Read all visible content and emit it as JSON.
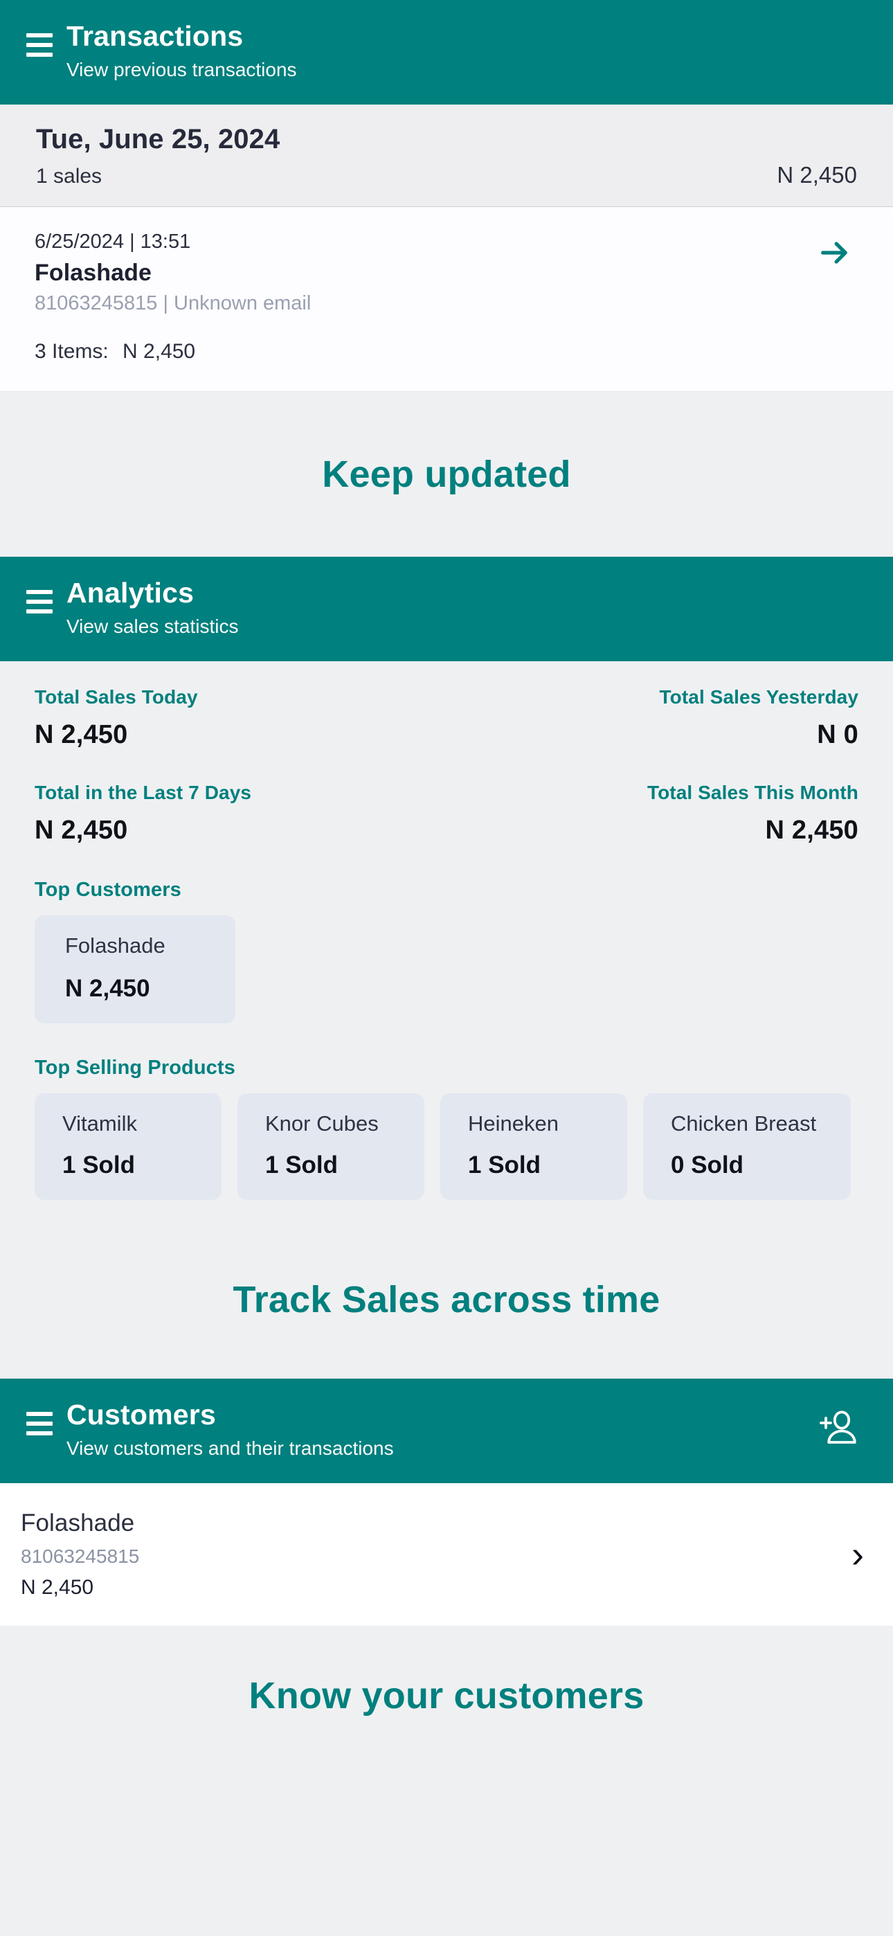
{
  "transactions": {
    "header": {
      "title": "Transactions",
      "subtitle": "View previous transactions",
      "menu_icon": "hamburger-menu-icon"
    },
    "date_group": {
      "date": "Tue, June 25, 2024",
      "sales_count": "1 sales",
      "total": "N 2,450"
    },
    "items": [
      {
        "timestamp": "6/25/2024 | 13:51",
        "customer": "Folashade",
        "contact": "81063245815 | Unknown email",
        "items_label": "3 Items:",
        "items_total": "N 2,450",
        "action_icon": "arrow-right-icon"
      }
    ]
  },
  "promo_1": {
    "text": "Keep updated"
  },
  "analytics": {
    "header": {
      "title": "Analytics",
      "subtitle": "View sales statistics",
      "menu_icon": "hamburger-menu-icon"
    },
    "stats": [
      {
        "label": "Total Sales Today",
        "value": "N 2,450"
      },
      {
        "label": "Total Sales Yesterday",
        "value": "N 0"
      },
      {
        "label": "Total in the Last 7 Days",
        "value": "N 2,450"
      },
      {
        "label": "Total Sales This Month",
        "value": "N 2,450"
      }
    ],
    "top_customers_label": "Top Customers",
    "top_customers": [
      {
        "name": "Folashade",
        "value": "N 2,450"
      }
    ],
    "top_products_label": "Top Selling Products",
    "top_products": [
      {
        "name": "Vitamilk",
        "value": "1 Sold"
      },
      {
        "name": "Knor Cubes",
        "value": "1 Sold"
      },
      {
        "name": "Heineken",
        "value": "1 Sold"
      },
      {
        "name": "Chicken Breast",
        "value": "0 Sold"
      }
    ]
  },
  "promo_2": {
    "text": "Track Sales across time"
  },
  "customers": {
    "header": {
      "title": "Customers",
      "subtitle": "View customers and their transactions",
      "menu_icon": "hamburger-menu-icon",
      "add_icon": "add-person-icon"
    },
    "rows": [
      {
        "name": "Folashade",
        "phone": "81063245815",
        "amount": "N 2,450",
        "chevron": "›"
      }
    ]
  },
  "promo_3": {
    "text": "Know your customers"
  },
  "colors": {
    "brand_teal": "#00807E",
    "page_bg": "#EFF0F2",
    "card_bg": "#FDFDFF",
    "chip_bg": "#E3E7F0",
    "text_dark": "#2B2F3E",
    "text_muted": "#9AA0B0"
  }
}
